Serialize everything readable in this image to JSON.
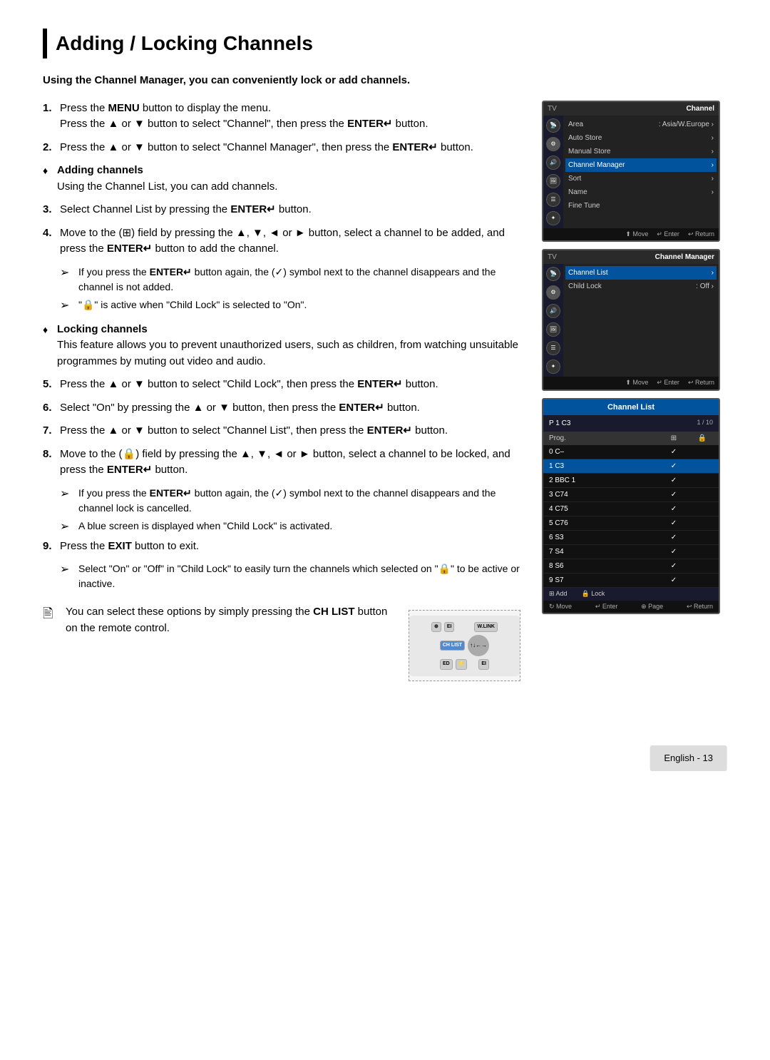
{
  "page": {
    "title": "Adding / Locking Channels",
    "footer": "English - 13"
  },
  "intro": {
    "text": "Using the Channel Manager, you can conveniently lock or add channels."
  },
  "steps": [
    {
      "num": "1.",
      "lines": [
        "Press the MENU button to display the menu.",
        "Press the ▲ or ▼ button to select \"Channel\", then press the ENTER↵ button."
      ]
    },
    {
      "num": "2.",
      "lines": [
        "Press the ▲ or ▼ button to select \"Channel Manager\", then press the ENTER↵ button."
      ]
    },
    {
      "num": "3.",
      "lines": [
        "Select Channel List by pressing the ENTER↵ button."
      ]
    },
    {
      "num": "4.",
      "lines": [
        "Move to the (⊞) field by pressing the ▲, ▼, ◄ or ► button, select a channel to be added, and press the ENTER↵ button to add the channel."
      ]
    },
    {
      "num": "5.",
      "lines": [
        "Press the ▲ or ▼ button to select \"Child Lock\", then press the ENTER↵ button."
      ]
    },
    {
      "num": "6.",
      "lines": [
        "Select \"On\" by pressing the ▲ or ▼ button, then press the ENTER↵ button."
      ]
    },
    {
      "num": "7.",
      "lines": [
        "Press the ▲ or ▼ button to select \"Channel List\", then press the ENTER↵ button."
      ]
    },
    {
      "num": "8.",
      "lines": [
        "Move to the (🔒) field by pressing the ▲, ▼, ◄ or ► button, select a channel to be locked, and press the ENTER↵ button."
      ]
    },
    {
      "num": "9.",
      "lines": [
        "Press the EXIT button to exit."
      ]
    }
  ],
  "bullets": [
    {
      "title": "Adding channels",
      "text": "Using the Channel List, you can add channels."
    },
    {
      "title": "Locking channels",
      "text": "This feature allows you to prevent unauthorized users, such as children, from watching unsuitable programmes by muting out video and audio."
    }
  ],
  "arrow_notes": [
    {
      "step_after": 4,
      "text": "If you press the ENTER↵ button again, the (✓) symbol next to the channel disappears and the channel is not added."
    },
    {
      "step_after": 4,
      "text": "\"🔒\" is active when \"Child Lock\" is selected to \"On\"."
    },
    {
      "step_after": 8,
      "text": "If you press the ENTER↵ button again, the (✓) symbol next to the channel disappears and the channel lock is cancelled."
    },
    {
      "step_after": 8,
      "text": "A blue screen is displayed when \"Child Lock\" is activated."
    },
    {
      "step_after": 9,
      "text": "Select \"On\" or \"Off\" in \"Child Lock\" to easily turn the channels which selected on \"🔒\" to be active or inactive."
    }
  ],
  "note": {
    "text": "You can select these options by simply pressing the CH LIST button on the remote control."
  },
  "screens": {
    "channel_menu": {
      "header_left": "TV",
      "header_right": "Channel",
      "items": [
        {
          "label": "Area",
          "value": ": Asia/W.Europe",
          "arrow": true
        },
        {
          "label": "Auto Store",
          "value": "",
          "arrow": true
        },
        {
          "label": "Manual Store",
          "value": "",
          "arrow": true
        },
        {
          "label": "Channel Manager",
          "value": "",
          "arrow": true,
          "highlighted": true
        },
        {
          "label": "Sort",
          "value": "",
          "arrow": true
        },
        {
          "label": "Name",
          "value": "",
          "arrow": true
        },
        {
          "label": "Fine Tune",
          "value": "",
          "arrow": false
        }
      ],
      "footer": [
        "Move",
        "Enter",
        "Return"
      ]
    },
    "channel_manager": {
      "header_left": "TV",
      "header_right": "Channel Manager",
      "items": [
        {
          "label": "Channel List",
          "value": "",
          "arrow": true
        },
        {
          "label": "Child Lock",
          "value": ": Off",
          "arrow": true
        }
      ],
      "footer": [
        "Move",
        "Enter",
        "Return"
      ]
    },
    "channel_list": {
      "header": "Channel List",
      "selected_channel": "P 1 C3",
      "count": "1 / 10",
      "channels": [
        {
          "prog": "0  C–",
          "add": "✓",
          "lock": "",
          "highlighted": false
        },
        {
          "prog": "1  C3",
          "add": "✓",
          "lock": "",
          "highlighted": true
        },
        {
          "prog": "2  BBC 1",
          "add": "✓",
          "lock": "",
          "highlighted": false
        },
        {
          "prog": "3  C74",
          "add": "✓",
          "lock": "",
          "highlighted": false
        },
        {
          "prog": "4  C75",
          "add": "✓",
          "lock": "",
          "highlighted": false
        },
        {
          "prog": "5  C76",
          "add": "✓",
          "lock": "",
          "highlighted": false
        },
        {
          "prog": "6  S3",
          "add": "✓",
          "lock": "",
          "highlighted": false
        },
        {
          "prog": "7  S4",
          "add": "✓",
          "lock": "",
          "highlighted": false
        },
        {
          "prog": "8  S6",
          "add": "✓",
          "lock": "",
          "highlighted": false
        },
        {
          "prog": "9  S7",
          "add": "✓",
          "lock": "",
          "highlighted": false
        }
      ],
      "actions": [
        "Add",
        "Lock"
      ],
      "footer": [
        "Move",
        "Enter",
        "Page",
        "Return"
      ]
    }
  }
}
